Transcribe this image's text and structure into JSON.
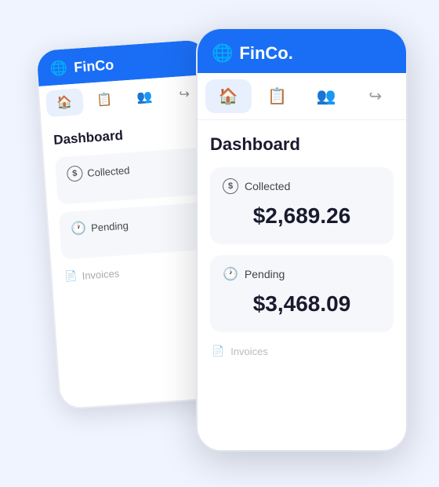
{
  "app": {
    "name": "FinCo.",
    "logo_symbol": "🌐"
  },
  "nav": {
    "items": [
      {
        "icon": "🏠",
        "label": "home",
        "active": true
      },
      {
        "icon": "📋",
        "label": "documents",
        "active": false
      },
      {
        "icon": "👥",
        "label": "users",
        "active": false
      },
      {
        "icon": "↪",
        "label": "logout",
        "active": false
      }
    ]
  },
  "dashboard": {
    "title": "Dashboard",
    "collected": {
      "label": "Collected",
      "value": "$2,689.26"
    },
    "pending": {
      "label": "Pending",
      "value": "$3,468.09"
    },
    "invoices_label": "Invoices"
  }
}
